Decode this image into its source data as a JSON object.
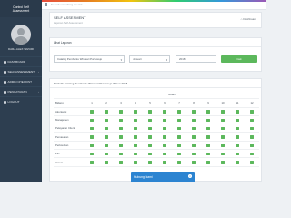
{
  "sidebar": {
    "brand_line1": "Control Self",
    "brand_line2": "Assessment",
    "user_name": "DARA ALEX WIZURI",
    "items": [
      {
        "label": "DASHBOARD",
        "icon": "dashboard-icon"
      },
      {
        "label": "SELF ASSESSMENT",
        "icon": "list-icon"
      },
      {
        "label": "ADMIN CHECKIST",
        "icon": "clipboard-icon"
      },
      {
        "label": "PENGATURAN",
        "icon": "gear-icon"
      },
      {
        "label": "LOGOUT",
        "icon": "logout-icon"
      }
    ]
  },
  "topbar": {
    "search_placeholder": "Search something special"
  },
  "page": {
    "title": "SELF ASSESMENT",
    "subtitle": "Laporan Self Assessment",
    "dashboard_link": "Dashboard"
  },
  "filter": {
    "title": "Lihat Laporan",
    "select1": "Catalog Pembantu Wirosari Purworejo",
    "select2": "Januari",
    "select3": "2018",
    "button": "Cek"
  },
  "table": {
    "title": "Statistik Catalog Pembantu Wirosari Purworejo Tahun 2018",
    "bulan_label": "Bulan",
    "col_bidang": "Bidang",
    "months": [
      "1",
      "2",
      "3",
      "4",
      "5",
      "6",
      "7",
      "8",
      "9",
      "10",
      "11",
      "12"
    ],
    "rows": [
      "Akuntansi",
      "Manajemen",
      "Pelayanan Client",
      "Pemasaran",
      "Perkreditan",
      "TSI",
      "Umum"
    ]
  },
  "popup": {
    "label": "Hubungi kami"
  },
  "colors": {
    "sidebar": "#2d3e50",
    "ok_button": "#5cb85c",
    "check": "#5cb85c",
    "popup": "#2c84d1"
  }
}
